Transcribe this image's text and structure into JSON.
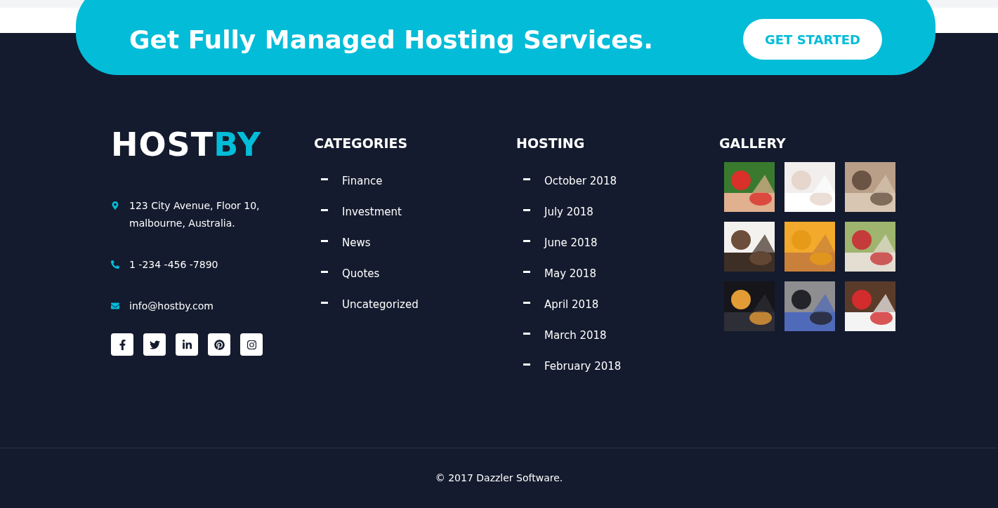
{
  "banner": {
    "title": "Get Fully Managed Hosting Services.",
    "button": "GET STARTED"
  },
  "logo": {
    "first": "HOST",
    "second": "BY"
  },
  "contact": [
    {
      "kind": "address",
      "text": "123 City Avenue, Floor 10, malbourne, Australia."
    },
    {
      "kind": "phone",
      "text": "1 -234 -456 -7890"
    },
    {
      "kind": "email",
      "text": "info@hostby.com"
    }
  ],
  "social": [
    {
      "kind": "facebook"
    },
    {
      "kind": "twitter"
    },
    {
      "kind": "linkedin"
    },
    {
      "kind": "pinterest"
    },
    {
      "kind": "instagram"
    }
  ],
  "categories": {
    "title": "CATEGORIES",
    "items": [
      "Finance",
      "Investment",
      "News",
      "Quotes",
      "Uncategorized"
    ]
  },
  "hosting": {
    "title": "HOSTING",
    "items": [
      "October 2018",
      "July 2018",
      "June 2018",
      "May 2018",
      "April 2018",
      "March 2018",
      "February 2018"
    ]
  },
  "gallery": {
    "title": "GALLERY"
  },
  "copyright": "© 2017 Dazzler Software."
}
